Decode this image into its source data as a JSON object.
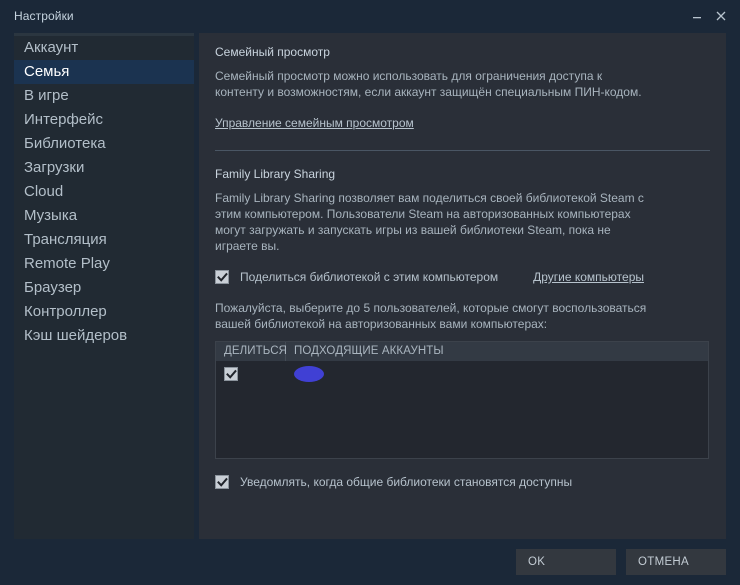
{
  "window": {
    "title": "Настройки",
    "minimize_icon": "minimize-icon",
    "close_icon": "close-icon"
  },
  "sidebar": {
    "items": [
      {
        "label": "Аккаунт",
        "selected": false
      },
      {
        "label": "Семья",
        "selected": true
      },
      {
        "label": "В игре",
        "selected": false
      },
      {
        "label": "Интерфейс",
        "selected": false
      },
      {
        "label": "Библиотека",
        "selected": false
      },
      {
        "label": "Загрузки",
        "selected": false
      },
      {
        "label": "Cloud",
        "selected": false
      },
      {
        "label": "Музыка",
        "selected": false
      },
      {
        "label": "Трансляция",
        "selected": false
      },
      {
        "label": "Remote Play",
        "selected": false
      },
      {
        "label": "Браузер",
        "selected": false
      },
      {
        "label": "Контроллер",
        "selected": false
      },
      {
        "label": "Кэш шейдеров",
        "selected": false
      }
    ]
  },
  "main": {
    "family_view": {
      "title": "Семейный просмотр",
      "description": "Семейный просмотр можно использовать для ограничения доступа к контенту и возможностям, если аккаунт защищён специальным ПИН-кодом.",
      "manage_link": "Управление семейным просмотром"
    },
    "library_sharing": {
      "title": "Family Library Sharing",
      "description": "Family Library Sharing позволяет вам поделиться своей библиотекой Steam с этим компьютером. Пользователи Steam на авторизованных компьютерах могут загружать и запускать игры из вашей библиотеки Steam, пока не играете вы.",
      "share_checkbox_label": "Поделиться библиотекой с этим компьютером",
      "share_checkbox_checked": true,
      "other_computers_link": "Другие компьютеры",
      "instructions": "Пожалуйста, выберите до 5 пользователей, которые смогут воспользоваться вашей библиотекой на авторизованных вами компьютерах:",
      "table": {
        "columns": [
          "ДЕЛИТЬСЯ",
          "ПОДХОДЯЩИЕ АККАУНТЫ"
        ],
        "rows": [
          {
            "share_checked": true,
            "account": ""
          }
        ]
      },
      "notify_checkbox_label": "Уведомлять, когда общие библиотеки становятся доступны",
      "notify_checkbox_checked": true
    }
  },
  "footer": {
    "ok_label": "OK",
    "cancel_label": "ОТМЕНА"
  },
  "colors": {
    "window_bg": "#1b2838",
    "panel_bg": "#2a2f38",
    "sidebar_bg": "#212a33",
    "selected_bg": "#1b3350",
    "redaction": "#4040d4"
  }
}
